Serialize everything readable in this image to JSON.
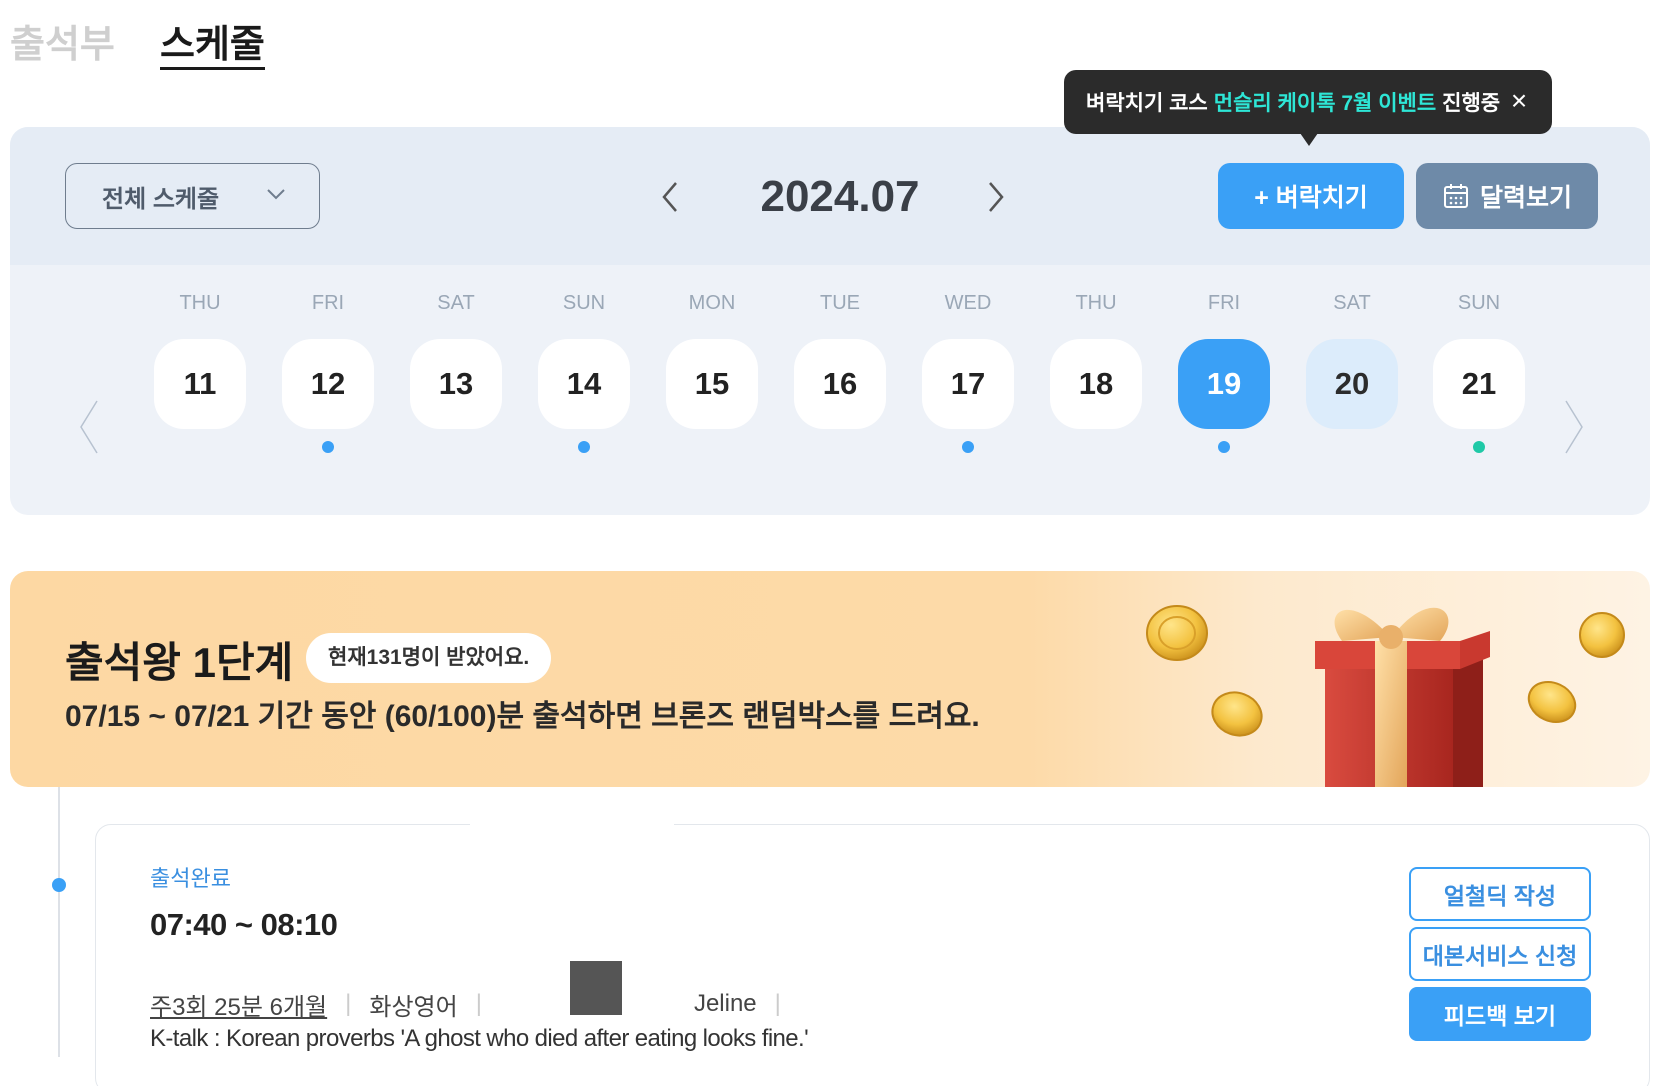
{
  "tabs": [
    {
      "label": "출석부",
      "active": false
    },
    {
      "label": "스케줄",
      "active": true
    }
  ],
  "tooltip": {
    "segments": [
      {
        "text": "벼락치기 코스",
        "highlight": false
      },
      {
        "text": "먼슬리 케이톡 7월 이벤트",
        "highlight": true
      },
      {
        "text": "진행중",
        "highlight": false
      }
    ],
    "close_icon": "×"
  },
  "schedule": {
    "filter_label": "전체 스케줄",
    "month_label": "2024.07",
    "add_button_label": "+ 벼락치기",
    "calendar_button_label": "달력보기",
    "days": [
      {
        "dow": "THU",
        "date": "11",
        "state": "normal",
        "dot": "none"
      },
      {
        "dow": "FRI",
        "date": "12",
        "state": "normal",
        "dot": "blue"
      },
      {
        "dow": "SAT",
        "date": "13",
        "state": "normal",
        "dot": "none"
      },
      {
        "dow": "SUN",
        "date": "14",
        "state": "normal",
        "dot": "blue"
      },
      {
        "dow": "MON",
        "date": "15",
        "state": "normal",
        "dot": "none"
      },
      {
        "dow": "TUE",
        "date": "16",
        "state": "normal",
        "dot": "none"
      },
      {
        "dow": "WED",
        "date": "17",
        "state": "normal",
        "dot": "blue"
      },
      {
        "dow": "THU",
        "date": "18",
        "state": "normal",
        "dot": "none"
      },
      {
        "dow": "FRI",
        "date": "19",
        "state": "selected",
        "dot": "blue"
      },
      {
        "dow": "SAT",
        "date": "20",
        "state": "today",
        "dot": "none"
      },
      {
        "dow": "SUN",
        "date": "21",
        "state": "normal",
        "dot": "teal"
      }
    ]
  },
  "banner": {
    "title": "출석왕 1단계",
    "pill": "현재131명이 받았어요.",
    "description": "07/15 ~ 07/21 기간 동안 (60/100)분 출석하면 브론즈 랜덤박스를 드려요."
  },
  "lesson": {
    "status": "출석완료",
    "time": "07:40 ~ 08:10",
    "plan": "주3회 25분 6개월",
    "course": "화상영어",
    "tutor": "Jeline",
    "topic": "K-talk : Korean proverbs 'A ghost who died after eating looks fine.'",
    "buttons": {
      "write": "얼철딕 작성",
      "script": "대본서비스 신청",
      "feedback": "피드백 보기"
    }
  },
  "colors": {
    "accent": "#3aa0f6",
    "teal_dot": "#1fc9a7",
    "tooltip_highlight": "#2ee6d6"
  }
}
